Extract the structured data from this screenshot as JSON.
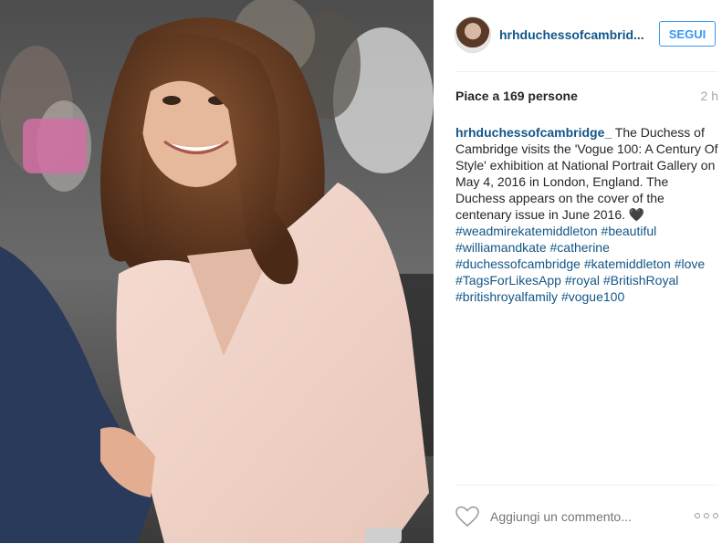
{
  "post": {
    "username": "hrhduchessofcambrid...",
    "follow_label": "SEGUI",
    "likes": "Piace a 169 persone",
    "time_ago": "2 h",
    "caption_author": "hrhduchessofcambridge_",
    "caption_text": "The Duchess of Cambridge visits the 'Vogue 100: A Century Of Style' exhibition at National Portrait Gallery on May 4, 2016 in London, England. The Duchess appears on the cover of the centenary issue in June 2016. 🖤",
    "hashtags": [
      "#weadmirekatemiddleton",
      "#beautiful",
      "#williamandkate",
      "#catherine",
      "#duchessofcambridge",
      "#katemiddleton",
      "#love",
      "#TagsForLikesApp",
      "#royal",
      "#BritishRoyal",
      "#britishroyalfamily",
      "#vogue100"
    ],
    "comment_placeholder": "Aggiungi un commento...",
    "icons": {
      "like": "heart-icon",
      "more": "more-options-icon"
    }
  },
  "colors": {
    "link": "#125688",
    "follow_button": "#3897f0",
    "muted": "#a5a7aa",
    "divider": "#efefef"
  }
}
